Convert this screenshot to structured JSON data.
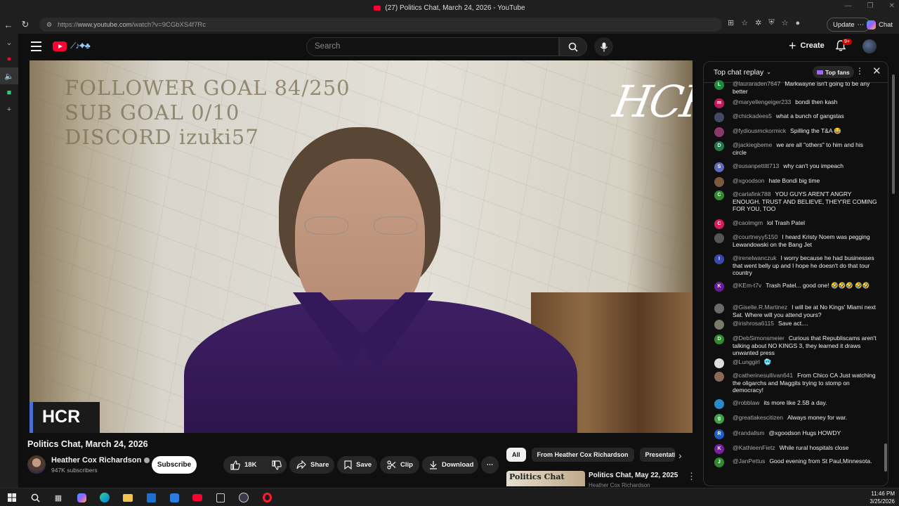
{
  "window": {
    "title": "(27) Politics Chat, March 24, 2026 - YouTube"
  },
  "address_bar": {
    "url_prefix": "https://",
    "url_host": "www.youtube.com",
    "url_path": "/watch?v=9CGbXS4f7Rc",
    "update_label": "Update",
    "chat_label": "Chat"
  },
  "header": {
    "search_placeholder": "Search",
    "create_label": "Create",
    "notification_count": "9+"
  },
  "video": {
    "overlay_line1": "FOLLOWER GOAL  84/250",
    "overlay_line2": "SUB GOAL  0/10",
    "overlay_line3": "DISCORD  izuki57",
    "signature": "HCR",
    "corner_badge": "HCR"
  },
  "info": {
    "title": "Politics Chat, March 24, 2026",
    "channel": "Heather Cox Richardson",
    "subscribers": "947K subscribers",
    "subscribe_label": "Subscribe",
    "like_count": "18K",
    "share_label": "Share",
    "save_label": "Save",
    "clip_label": "Clip",
    "download_label": "Download"
  },
  "chips": [
    "All",
    "From Heather Cox Richardson",
    "Presentati"
  ],
  "recommended": {
    "thumb_text": "Politics Chat",
    "title": "Politics Chat, May 22, 2025",
    "channel": "Heather Cox Richardson"
  },
  "chat": {
    "header": "Top chat replay",
    "top_fans_label": "Top fans",
    "messages": [
      {
        "initial": "L",
        "color": "#1e8a3c",
        "author": "@lauraraden7647",
        "text": "Markwayne isn't going to be any better"
      },
      {
        "initial": "m",
        "color": "#c2185b",
        "author": "@maryellengeiger233",
        "text": "bondi then kash"
      },
      {
        "initial": "",
        "color": "#444a66",
        "author": "@chickadees5",
        "text": "what a bunch of gangstas"
      },
      {
        "initial": "",
        "color": "#8a3a6a",
        "author": "@fydiousmckormick",
        "text": "Spilling the T&A 😂"
      },
      {
        "initial": "D",
        "color": "#1e7a4c",
        "author": "@jackiegbeme",
        "text": "we are all \"others\" to him and his circle"
      },
      {
        "initial": "S",
        "color": "#5c6bc0",
        "author": "@susanpettitt713",
        "text": "why can't you impeach"
      },
      {
        "initial": "",
        "color": "#7a5a3a",
        "author": "@xgoodson",
        "text": "hate Bondi big time"
      },
      {
        "initial": "C",
        "color": "#2e8b2e",
        "author": "@carlafink788",
        "text": "YOU GUYS AREN'T ANGRY ENOUGH. TRUST AND BELIEVE, THEY'RE COMING FOR YOU, TOO"
      },
      {
        "initial": "C",
        "color": "#d81b60",
        "author": "@caolmgm",
        "text": "lol Trash Patel"
      },
      {
        "initial": "",
        "color": "#555555",
        "author": "@courtneyy5150",
        "text": "I heard Kristy Noem was pegging Lewandowski on the Bang Jet"
      },
      {
        "initial": "I",
        "color": "#3949ab",
        "author": "@irenelwanczuk",
        "text": "I worry because he had businesses that went belly up and I hope he doesn't do that tour country"
      },
      {
        "initial": "K",
        "color": "#6a1b9a",
        "author": "@KEm-t7v",
        "text": "Trash Patel... good one! 🤣🤣🤣 🤣🤣"
      },
      {
        "initial": "",
        "color": "#6a6a6a",
        "author": "@Giselle.R.Martinez",
        "text": "I will be at No Kings' Miami next Sat. Where will you attend yours?"
      },
      {
        "initial": "",
        "color": "#7a7a6a",
        "author": "@irishrosa6115",
        "text": "Save act...."
      },
      {
        "initial": "D",
        "color": "#2e8b2e",
        "author": "@DebSimonsmeier",
        "text": "Curious that Republiscams aren't talking about NO KINGS 3, they learned it draws unwanted press"
      },
      {
        "initial": "",
        "color": "#dddddd",
        "author": "@Lunggirl",
        "text": "🥶"
      },
      {
        "initial": "",
        "color": "#8a6a5a",
        "author": "@catherinesullivan641",
        "text": "From Chico CA Just watching the oligarchs and Maggits trying to stomp on democracy!"
      },
      {
        "initial": "",
        "color": "#2a8ac8",
        "author": "@robblaw",
        "text": "its more like 2.5B a day."
      },
      {
        "initial": "g",
        "color": "#43a047",
        "author": "@greatlakescitizen",
        "text": "Always money for war."
      },
      {
        "initial": "R",
        "color": "#1e5fc8",
        "author": "@randallsm",
        "text": "@xgoodson Hugs HOWDY"
      },
      {
        "initial": "K",
        "color": "#7b1fa2",
        "author": "@KathleenFietz",
        "text": "While rural hospitals close"
      },
      {
        "initial": "J",
        "color": "#2e8b2e",
        "author": "@JanPettus",
        "text": "Good evening from St Paul,Minnesota."
      }
    ]
  },
  "taskbar": {
    "time": "11:46 PM",
    "date": "3/25/2026"
  }
}
